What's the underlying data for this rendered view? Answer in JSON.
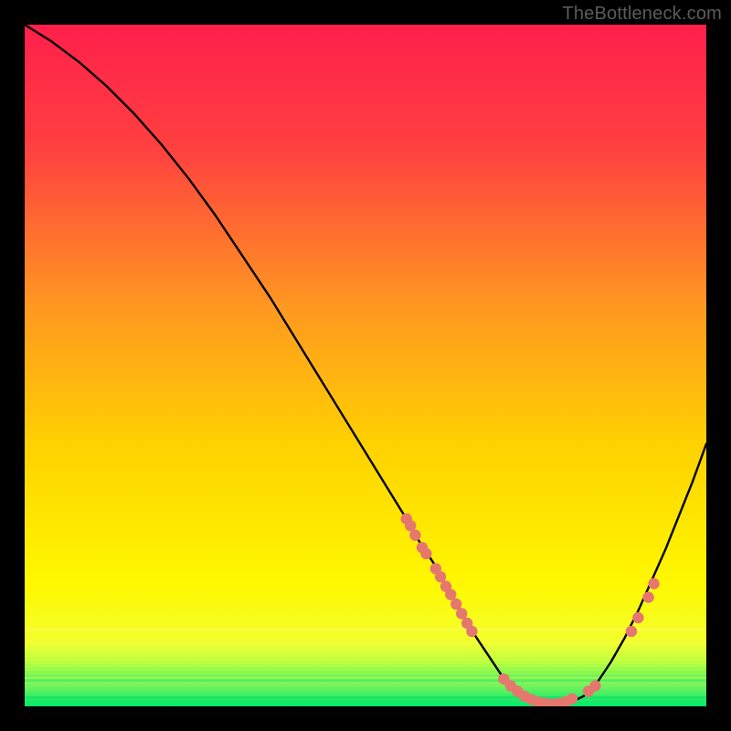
{
  "watermark": "TheBottleneck.com",
  "colors": {
    "gradient_top": "#ff1f4b",
    "gradient_mid1": "#ff7a2a",
    "gradient_mid2": "#ffd200",
    "gradient_mid3": "#fff800",
    "gradient_bottom": "#00e86b",
    "curve": "#000000",
    "marker": "#e6776e"
  },
  "chart_data": {
    "type": "line",
    "title": "",
    "xlabel": "",
    "ylabel": "",
    "xlim": [
      0,
      100
    ],
    "ylim": [
      0,
      100
    ],
    "grid": false,
    "legend": false,
    "series": [
      {
        "name": "bottleneck-curve",
        "x": [
          0,
          4,
          8,
          12,
          16,
          20,
          24,
          28,
          32,
          36,
          40,
          44,
          48,
          52,
          56,
          58,
          60,
          62,
          64,
          66,
          68,
          70,
          72,
          74,
          76,
          78,
          80,
          82,
          84,
          86,
          88,
          90,
          92,
          94,
          96,
          98,
          100
        ],
        "y": [
          100,
          97.5,
          94.5,
          91,
          87,
          82.5,
          77.5,
          72,
          66,
          60,
          53.5,
          47,
          40.5,
          34,
          27.5,
          24,
          21,
          17.5,
          14,
          10.5,
          7.5,
          4.5,
          2.5,
          1.2,
          0.5,
          0.3,
          0.5,
          1.5,
          3.5,
          6.5,
          10,
          14,
          18.5,
          23,
          28,
          33,
          38.5
        ]
      }
    ],
    "markers": [
      {
        "name": "cluster-left-upper",
        "points": [
          {
            "x": 56,
            "y": 27.5
          },
          {
            "x": 56.6,
            "y": 26.5
          },
          {
            "x": 57.3,
            "y": 25.1
          },
          {
            "x": 58.3,
            "y": 23.3
          },
          {
            "x": 58.9,
            "y": 22.4
          }
        ]
      },
      {
        "name": "cluster-left-lower",
        "points": [
          {
            "x": 60.3,
            "y": 20.2
          },
          {
            "x": 61,
            "y": 19
          },
          {
            "x": 61.8,
            "y": 17.6
          },
          {
            "x": 62.5,
            "y": 16.4
          },
          {
            "x": 63.3,
            "y": 15
          },
          {
            "x": 64.1,
            "y": 13.6
          },
          {
            "x": 64.9,
            "y": 12.2
          },
          {
            "x": 65.6,
            "y": 11
          }
        ]
      },
      {
        "name": "cluster-bottom",
        "points": [
          {
            "x": 70.3,
            "y": 4
          },
          {
            "x": 71.3,
            "y": 3
          },
          {
            "x": 72.3,
            "y": 2.2
          },
          {
            "x": 73.3,
            "y": 1.5
          },
          {
            "x": 74.3,
            "y": 1
          },
          {
            "x": 75.3,
            "y": 0.65
          },
          {
            "x": 76.3,
            "y": 0.45
          },
          {
            "x": 77.3,
            "y": 0.35
          },
          {
            "x": 78.3,
            "y": 0.4
          },
          {
            "x": 79.3,
            "y": 0.65
          },
          {
            "x": 80.3,
            "y": 1.1
          },
          {
            "x": 82.7,
            "y": 2.2
          },
          {
            "x": 83.7,
            "y": 3
          }
        ]
      },
      {
        "name": "cluster-right",
        "points": [
          {
            "x": 89,
            "y": 11
          },
          {
            "x": 90,
            "y": 13
          },
          {
            "x": 91.5,
            "y": 16
          },
          {
            "x": 92.3,
            "y": 18
          }
        ]
      }
    ]
  }
}
